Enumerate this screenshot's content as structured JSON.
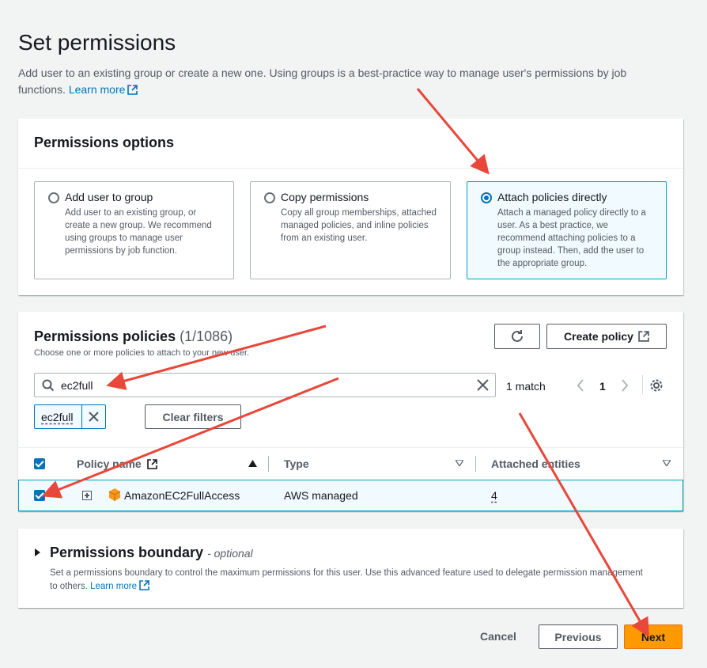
{
  "page": {
    "title": "Set permissions",
    "description": "Add user to an existing group or create a new one. Using groups is a best-practice way to manage user's permissions by job functions.",
    "learn_more": "Learn more"
  },
  "options": {
    "header": "Permissions options",
    "tiles": [
      {
        "title": "Add user to group",
        "desc": "Add user to an existing group, or create a new group. We recommend using groups to manage user permissions by job function.",
        "selected": false
      },
      {
        "title": "Copy permissions",
        "desc": "Copy all group memberships, attached managed policies, and inline policies from an existing user.",
        "selected": false
      },
      {
        "title": "Attach policies directly",
        "desc": "Attach a managed policy directly to a user. As a best practice, we recommend attaching policies to a group instead. Then, add the user to the appropriate group.",
        "selected": true
      }
    ]
  },
  "policies": {
    "header": "Permissions policies",
    "count": "(1/1086)",
    "description": "Choose one or more policies to attach to your new user.",
    "create_policy": "Create policy",
    "search_value": "ec2full",
    "match_text": "1 match",
    "page_number": "1",
    "filter_token": "ec2full",
    "clear_filters": "Clear filters",
    "columns": {
      "policy_name": "Policy name",
      "type": "Type",
      "attached": "Attached entities"
    },
    "rows": [
      {
        "name": "AmazonEC2FullAccess",
        "type": "AWS managed",
        "attached": "4",
        "checked": true
      }
    ]
  },
  "boundary": {
    "title": "Permissions boundary",
    "optional": "- optional",
    "description": "Set a permissions boundary to control the maximum permissions for this user. Use this advanced feature used to delegate permission management to others.",
    "learn_more": "Learn more"
  },
  "footer": {
    "cancel": "Cancel",
    "previous": "Previous",
    "next": "Next"
  },
  "colors": {
    "accent": "#0073bb",
    "primary_button": "#ff9900",
    "annotation_arrow": "#e8473a"
  }
}
